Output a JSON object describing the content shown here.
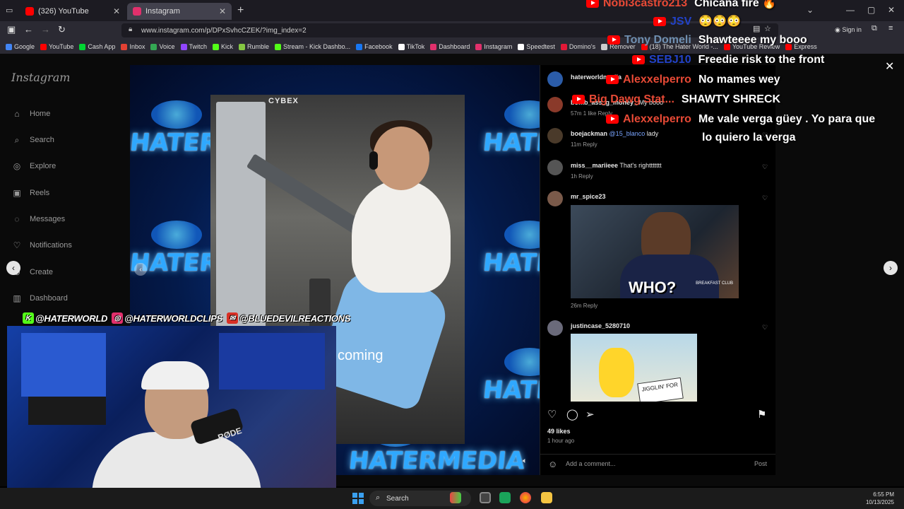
{
  "browser": {
    "tabs": [
      {
        "label": "(326) YouTube",
        "color": "#ff0000"
      },
      {
        "label": "Instagram",
        "color": "#e1306c"
      }
    ],
    "url": "www.instagram.com/p/DPxSvhcCZEK/?img_index=2",
    "sign_in": "Sign in",
    "bookmarks": [
      {
        "label": "Google",
        "color": "#4285f4"
      },
      {
        "label": "YouTube",
        "color": "#ff0000"
      },
      {
        "label": "Cash App",
        "color": "#00d632"
      },
      {
        "label": "Inbox",
        "color": "#e34133"
      },
      {
        "label": "Voice",
        "color": "#34a853"
      },
      {
        "label": "Twitch",
        "color": "#9146ff"
      },
      {
        "label": "Kick",
        "color": "#53fc18"
      },
      {
        "label": "Rumble",
        "color": "#85c742"
      },
      {
        "label": "Stream - Kick Dashbo...",
        "color": "#53fc18"
      },
      {
        "label": "Facebook",
        "color": "#1877f2"
      },
      {
        "label": "TikTok",
        "color": "#ffffff"
      },
      {
        "label": "Dashboard",
        "color": "#e1306c"
      },
      {
        "label": "Instagram",
        "color": "#e1306c"
      },
      {
        "label": "Speedtest",
        "color": "#ffffff"
      },
      {
        "label": "Domino's",
        "color": "#e31837"
      },
      {
        "label": "Remover",
        "color": "#cccccc"
      },
      {
        "label": "(18) The Hater World -...",
        "color": "#ff0000"
      },
      {
        "label": "YouTube Review",
        "color": "#ff0000"
      },
      {
        "label": "Express",
        "color": "#ff0000"
      }
    ]
  },
  "instagram": {
    "logo": "Instagram",
    "nav": [
      {
        "label": "Home",
        "icon": "home-icon",
        "glyph": "⌂"
      },
      {
        "label": "Search",
        "icon": "search-icon",
        "glyph": "⌕"
      },
      {
        "label": "Explore",
        "icon": "explore-icon",
        "glyph": "◎"
      },
      {
        "label": "Reels",
        "icon": "reels-icon",
        "glyph": "▣"
      },
      {
        "label": "Messages",
        "icon": "messages-icon",
        "glyph": "◌"
      },
      {
        "label": "Notifications",
        "icon": "heart-icon",
        "glyph": "♡"
      },
      {
        "label": "Create",
        "icon": "create-icon",
        "glyph": "⊕"
      },
      {
        "label": "Dashboard",
        "icon": "dashboard-icon",
        "glyph": "▥"
      }
    ],
    "media": {
      "watermark": "HATERMEDIA",
      "brand": "CYBEX",
      "caption": "coming",
      "gif_who": "WHO?",
      "gif_breakfast": "BREAKFAST CLUB",
      "gif_sign": "JIGGLIN' FOR"
    },
    "comments": [
      {
        "user": "haterworldmedia",
        "text": "",
        "meta": ""
      },
      {
        "user": "bomb_ass_g_money_",
        "text": "My booo",
        "meta": "57m  1 like  Reply"
      },
      {
        "user": "boejackman",
        "mention": "@15_blanco",
        "text": "lady",
        "meta": "11m  Reply"
      },
      {
        "user": "miss__mariieee",
        "text": "That's righttttttt",
        "meta": "1h  Reply"
      },
      {
        "user": "mr_spice23",
        "text": "",
        "meta": "26m  Reply"
      },
      {
        "user": "justincase_5280710",
        "text": "",
        "meta": ""
      }
    ],
    "likes": "49 likes",
    "posted": "1 hour ago",
    "add_comment_placeholder": "Add a comment...",
    "post_label": "Post"
  },
  "chat": [
    {
      "user": "Nobi3castro213",
      "msg": "Chicana fire 🔥",
      "user_color": "red"
    },
    {
      "user": "JSV",
      "msg": "😳😳😳",
      "user_color": "blue"
    },
    {
      "user": "Tony Domeli",
      "msg": "Shawteeee my booo",
      "user_color": "gray"
    },
    {
      "user": "SEBJ10",
      "msg": "Freedie risk to the front",
      "user_color": "blue"
    },
    {
      "user": "Alexxelperro",
      "msg": "No mames wey",
      "user_color": "red"
    },
    {
      "user": "Big Dawg Stat...",
      "msg": "SHAWTY SHRECK",
      "user_color": "red"
    },
    {
      "user": "Alexxelperro",
      "msg": "Me vale verga güey . Yo para que",
      "user_color": "red"
    },
    {
      "user": "",
      "msg": "lo quiero la verga",
      "user_color": "red"
    }
  ],
  "socials": [
    {
      "handle": "@HATERWORLD",
      "color": "#53fc18",
      "glyph": "K"
    },
    {
      "handle": "@HATERWORLDCLIPS",
      "color": "#e1306c",
      "glyph": "◎"
    },
    {
      "handle": "@BLUEDEVILREACTIONS",
      "color": "#d93025",
      "glyph": "✉"
    }
  ],
  "webcam": {
    "mic_label": "RØDE"
  },
  "taskbar": {
    "search_label": "Search",
    "time": "6:55 PM",
    "date": "10/13/2025"
  }
}
